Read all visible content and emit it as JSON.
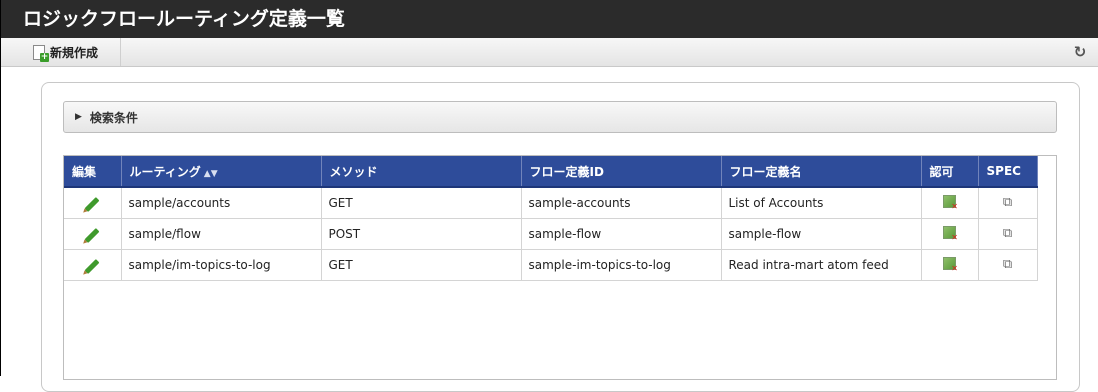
{
  "header": {
    "title": "ロジックフロールーティング定義一覧"
  },
  "toolbar": {
    "new_label": "新規作成"
  },
  "search": {
    "label": "検索条件"
  },
  "table": {
    "columns": [
      "編集",
      "ルーティング",
      "メソッド",
      "フロー定義ID",
      "フロー定義名",
      "認可",
      "SPEC"
    ],
    "rows": [
      {
        "routing": "sample/accounts",
        "method": "GET",
        "flow_id": "sample-accounts",
        "flow_name": "List of Accounts"
      },
      {
        "routing": "sample/flow",
        "method": "POST",
        "flow_id": "sample-flow",
        "flow_name": "sample-flow"
      },
      {
        "routing": "sample/im-topics-to-log",
        "method": "GET",
        "flow_id": "sample-im-topics-to-log",
        "flow_name": "Read intra-mart atom feed"
      }
    ]
  },
  "icons": {
    "new": "new-document-icon",
    "refresh": "refresh-icon",
    "expand": "triangle-right-icon",
    "edit": "pencil-icon",
    "authorize": "authorization-icon",
    "spec": "external-link-icon",
    "sort": "sort-icon"
  },
  "colors": {
    "header_bg": "#2b2b2b",
    "table_header": "#2e4c9a",
    "edit_green": "#3f9a2c"
  }
}
